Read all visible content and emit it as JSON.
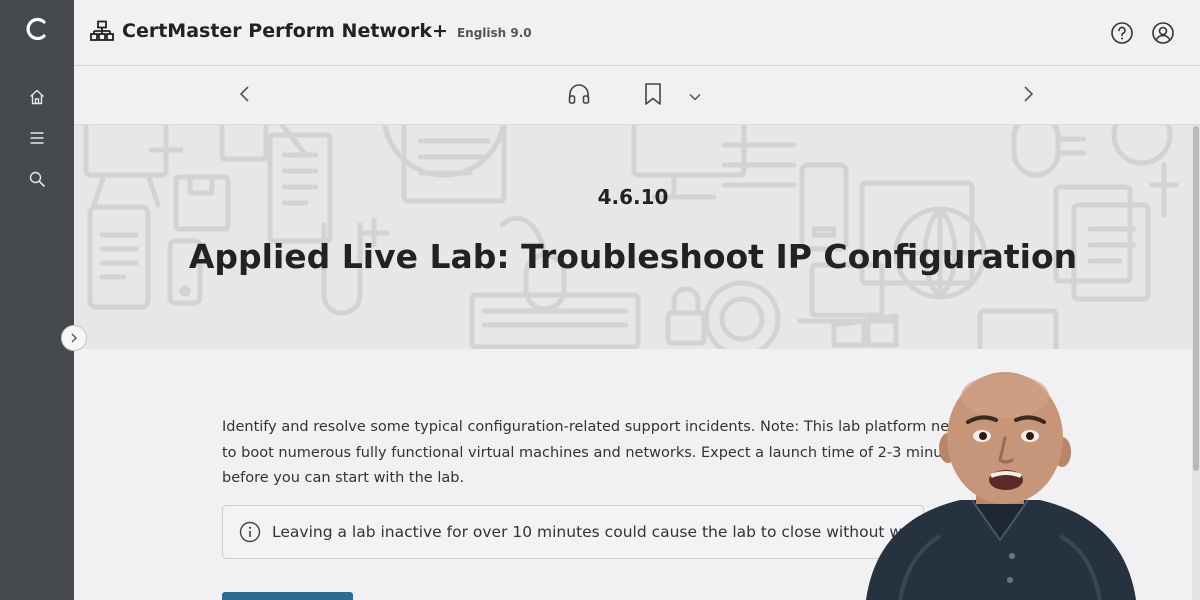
{
  "header": {
    "title": "CertMaster Perform Network+",
    "version": "English 9.0"
  },
  "hero": {
    "number": "4.6.10",
    "title": "Applied Live Lab: Troubleshoot IP Configuration"
  },
  "content": {
    "description": "Identify and resolve some typical configuration-related support incidents. Note: This lab platform needs to boot numerous fully functional virtual machines and networks. Expect a launch time of 2-3 minutes before you can start with the lab.",
    "notice": "Leaving a lab inactive for over 10 minutes could cause the lab to close without warning."
  },
  "colors": {
    "rail": "#46494e",
    "background": "#f1f1f3",
    "hero_bg": "#e7e7e9",
    "accent_button": "#2f6a90",
    "text": "#222222"
  },
  "icons": {
    "rail": [
      "app-logo-icon",
      "home-icon",
      "menu-icon",
      "search-icon"
    ],
    "header": [
      "network-icon",
      "help-icon",
      "user-icon"
    ],
    "toolbar": [
      "chevron-left-icon",
      "headphones-icon",
      "bookmark-icon",
      "chevron-down-icon",
      "chevron-right-icon"
    ],
    "notice": "info-icon"
  }
}
